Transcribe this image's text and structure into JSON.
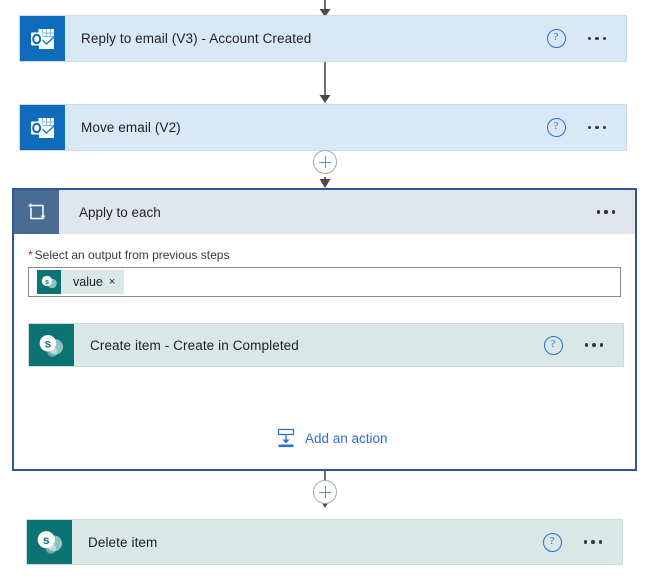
{
  "flow": {
    "nodes": [
      {
        "id": "reply-to-email",
        "title": "Reply to email (V3) - Account Created",
        "icon": "outlook-icon",
        "connector": "outlook",
        "help_label": "?",
        "menu_label": "More commands"
      },
      {
        "id": "move-email",
        "title": "Move email (V2)",
        "icon": "outlook-icon",
        "connector": "outlook",
        "help_label": "?",
        "menu_label": "More commands"
      },
      {
        "id": "apply-to-each",
        "title": "Apply to each",
        "icon": "loop-icon",
        "connector": "control",
        "menu_label": "More commands",
        "field": {
          "required_marker": "*",
          "label": "Select an output from previous steps",
          "token": {
            "text": "value",
            "remove_label": "×",
            "icon": "sharepoint-icon"
          }
        },
        "children": [
          {
            "id": "create-item",
            "title": "Create item - Create in Completed",
            "icon": "sharepoint-icon",
            "connector": "sharepoint",
            "help_label": "?",
            "menu_label": "More commands"
          }
        ],
        "add_action": {
          "label": "Add an action",
          "icon": "insert-action-icon"
        }
      },
      {
        "id": "delete-item",
        "title": "Delete item",
        "icon": "sharepoint-icon",
        "connector": "sharepoint",
        "help_label": "?",
        "menu_label": "More commands"
      }
    ],
    "insert_buttons": [
      {
        "id": "insert-after-move-email",
        "label": "+"
      },
      {
        "id": "insert-after-apply-to-each",
        "label": "+"
      }
    ],
    "colors": {
      "outlook_blue": "#0f6cbd",
      "outlook_card": "#d9e8f7",
      "sharepoint_teal": "#0b7373",
      "sharepoint_card": "#d9e7e7",
      "loop_header": "#e1e6ee",
      "loop_border": "#2f5596",
      "loop_icon_tile": "#4a6b94",
      "link_blue": "#2f6fd0",
      "required_red": "#a4262c"
    }
  }
}
